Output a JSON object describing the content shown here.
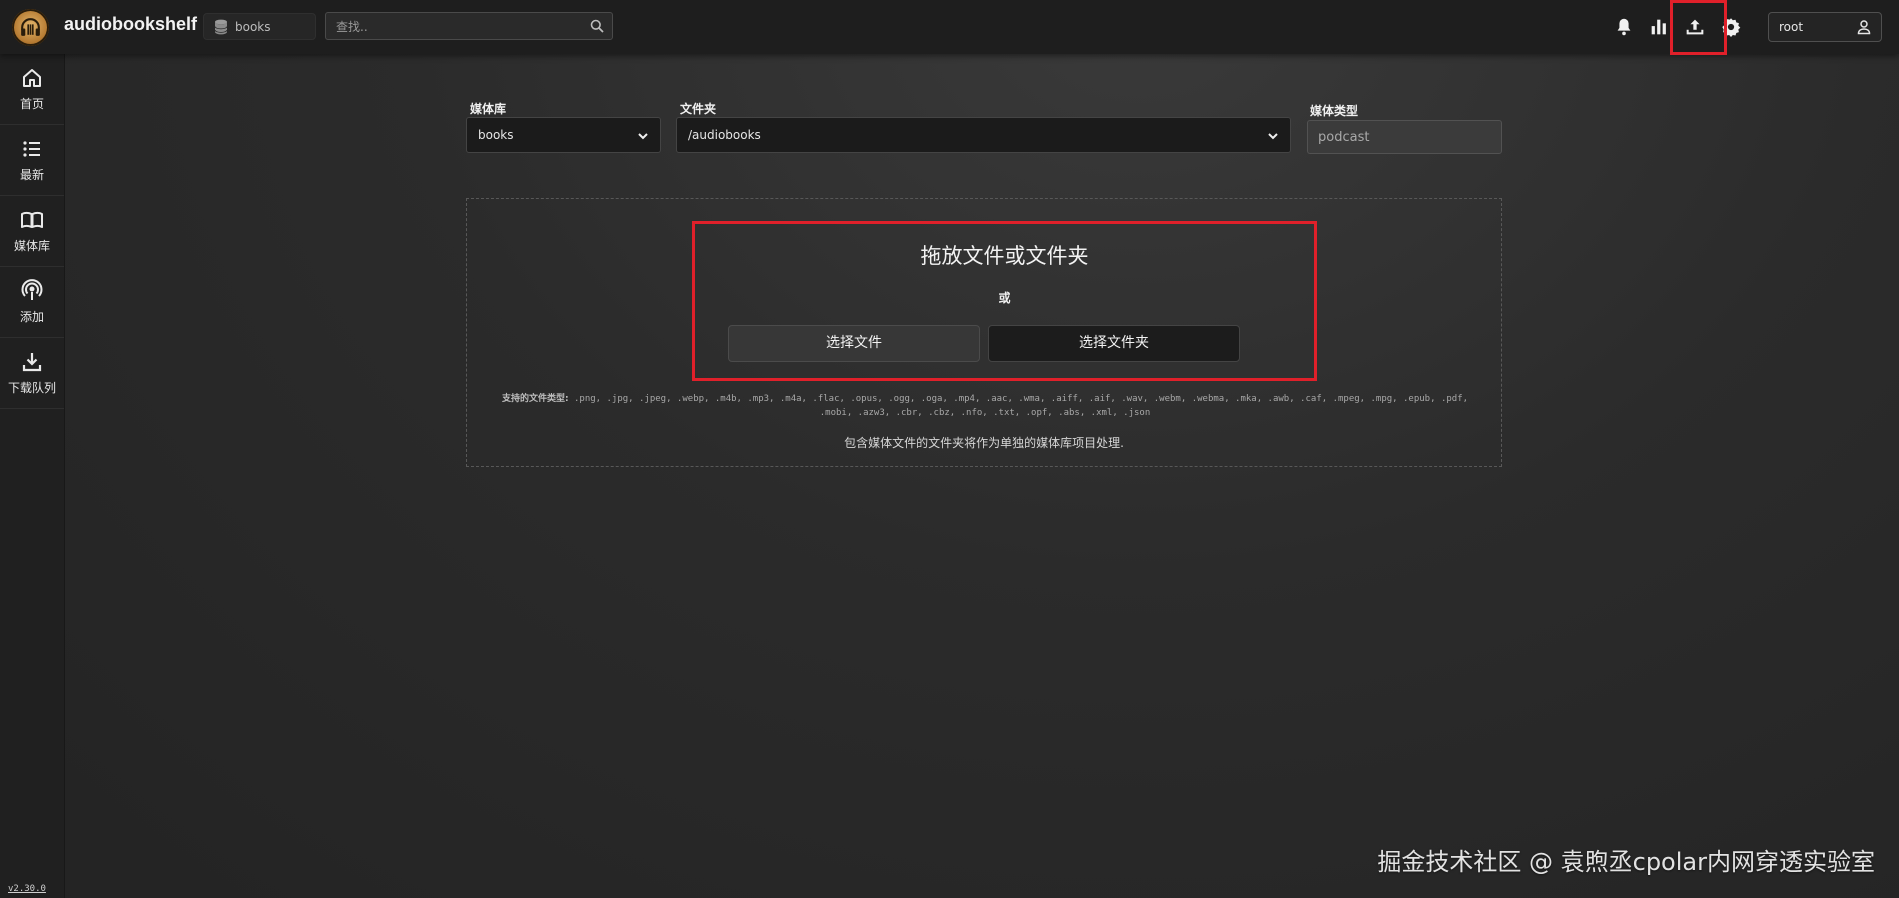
{
  "app": {
    "title": "audiobookshelf",
    "version": "v2.30.0",
    "accent_color": "#e0202a"
  },
  "header": {
    "library_selector": "books",
    "search_placeholder": "查找..",
    "icons": [
      "bell-icon",
      "stats-icon",
      "upload-icon",
      "settings-icon"
    ],
    "user": "root"
  },
  "sidebar": {
    "items": [
      {
        "label": "首页",
        "icon": "home-icon"
      },
      {
        "label": "最新",
        "icon": "list-icon"
      },
      {
        "label": "媒体库",
        "icon": "book-icon"
      },
      {
        "label": "添加",
        "icon": "podcast-icon"
      },
      {
        "label": "下载队列",
        "icon": "download-icon"
      }
    ]
  },
  "form": {
    "library_label": "媒体库",
    "library_value": "books",
    "folder_label": "文件夹",
    "folder_value": "/audiobooks",
    "media_type_label": "媒体类型",
    "media_type_value": "podcast"
  },
  "dropzone": {
    "title": "拖放文件或文件夹",
    "or_text": "或",
    "select_files_button": "选择文件",
    "select_folder_button": "选择文件夹",
    "supported_label": "支持的文件类型:",
    "supported_types": ".png, .jpg, .jpeg, .webp, .m4b, .mp3, .m4a, .flac, .opus, .ogg, .oga, .mp4, .aac, .wma, .aiff, .aif, .wav, .webm, .webma, .mka, .awb, .caf, .mpeg, .mpg, .epub, .pdf, .mobi, .azw3, .cbr, .cbz, .nfo, .txt, .opf, .abs, .xml, .json",
    "folder_note": "包含媒体文件的文件夹将作为单独的媒体库项目处理."
  },
  "watermark": "掘金技术社区 @ 袁煦丞cpolar内网穿透实验室"
}
